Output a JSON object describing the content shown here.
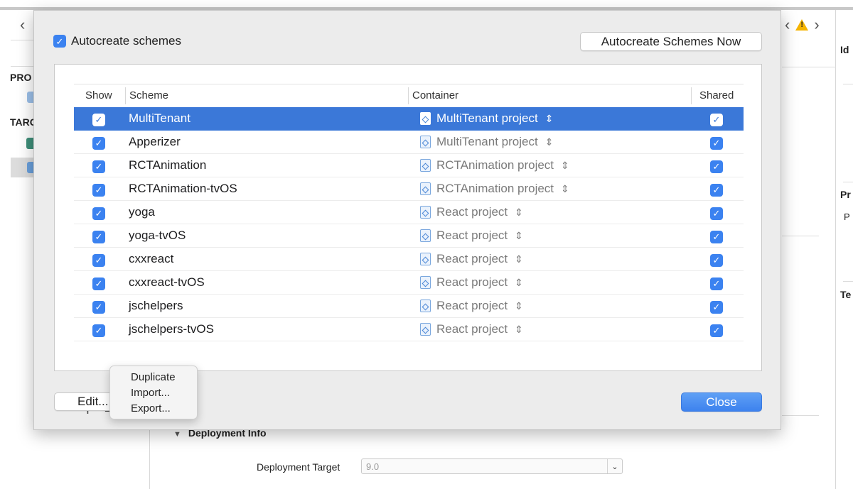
{
  "dialog": {
    "autocreate_label": "Autocreate schemes",
    "autocreate_checked": true,
    "autocreate_now_label": "Autocreate Schemes Now",
    "edit_label": "Edit...",
    "close_label": "Close"
  },
  "table": {
    "columns": [
      "Show",
      "Scheme",
      "Container",
      "Shared"
    ],
    "rows": [
      {
        "scheme": "MultiTenant",
        "container": "MultiTenant project",
        "show": true,
        "shared": true,
        "selected": true
      },
      {
        "scheme": "Apperizer",
        "container": "MultiTenant project",
        "show": true,
        "shared": true,
        "selected": false
      },
      {
        "scheme": "RCTAnimation",
        "container": "RCTAnimation project",
        "show": true,
        "shared": true,
        "selected": false
      },
      {
        "scheme": "RCTAnimation-tvOS",
        "container": "RCTAnimation project",
        "show": true,
        "shared": true,
        "selected": false
      },
      {
        "scheme": "yoga",
        "container": "React project",
        "show": true,
        "shared": true,
        "selected": false
      },
      {
        "scheme": "yoga-tvOS",
        "container": "React project",
        "show": true,
        "shared": true,
        "selected": false
      },
      {
        "scheme": "cxxreact",
        "container": "React project",
        "show": true,
        "shared": true,
        "selected": false
      },
      {
        "scheme": "cxxreact-tvOS",
        "container": "React project",
        "show": true,
        "shared": true,
        "selected": false
      },
      {
        "scheme": "jschelpers",
        "container": "React project",
        "show": true,
        "shared": true,
        "selected": false
      },
      {
        "scheme": "jschelpers-tvOS",
        "container": "React project",
        "show": true,
        "shared": true,
        "selected": false
      }
    ]
  },
  "toolbar": {
    "add_symbol": "+",
    "remove_symbol": "—",
    "gear_symbol": "⚙"
  },
  "menu": {
    "items": [
      "Duplicate",
      "Import...",
      "Export..."
    ]
  },
  "background": {
    "left_labels": [
      "PRO",
      "TARG"
    ],
    "right_labels": [
      "Id",
      "Pr",
      "P",
      "Te"
    ],
    "section_title": "Deployment Info",
    "deployment_target_label": "Deployment Target",
    "deployment_target_value": "9.0"
  },
  "icons": {
    "back": "chevron-left-icon",
    "forward": "chevron-right-icon",
    "warning": "warning-icon",
    "project": "xcode-project-icon",
    "updown": "up-down-chevron-icon"
  },
  "colors": {
    "accent": "#3b78d8",
    "checkbox": "#3b82f0",
    "warning": "#f5b400"
  }
}
